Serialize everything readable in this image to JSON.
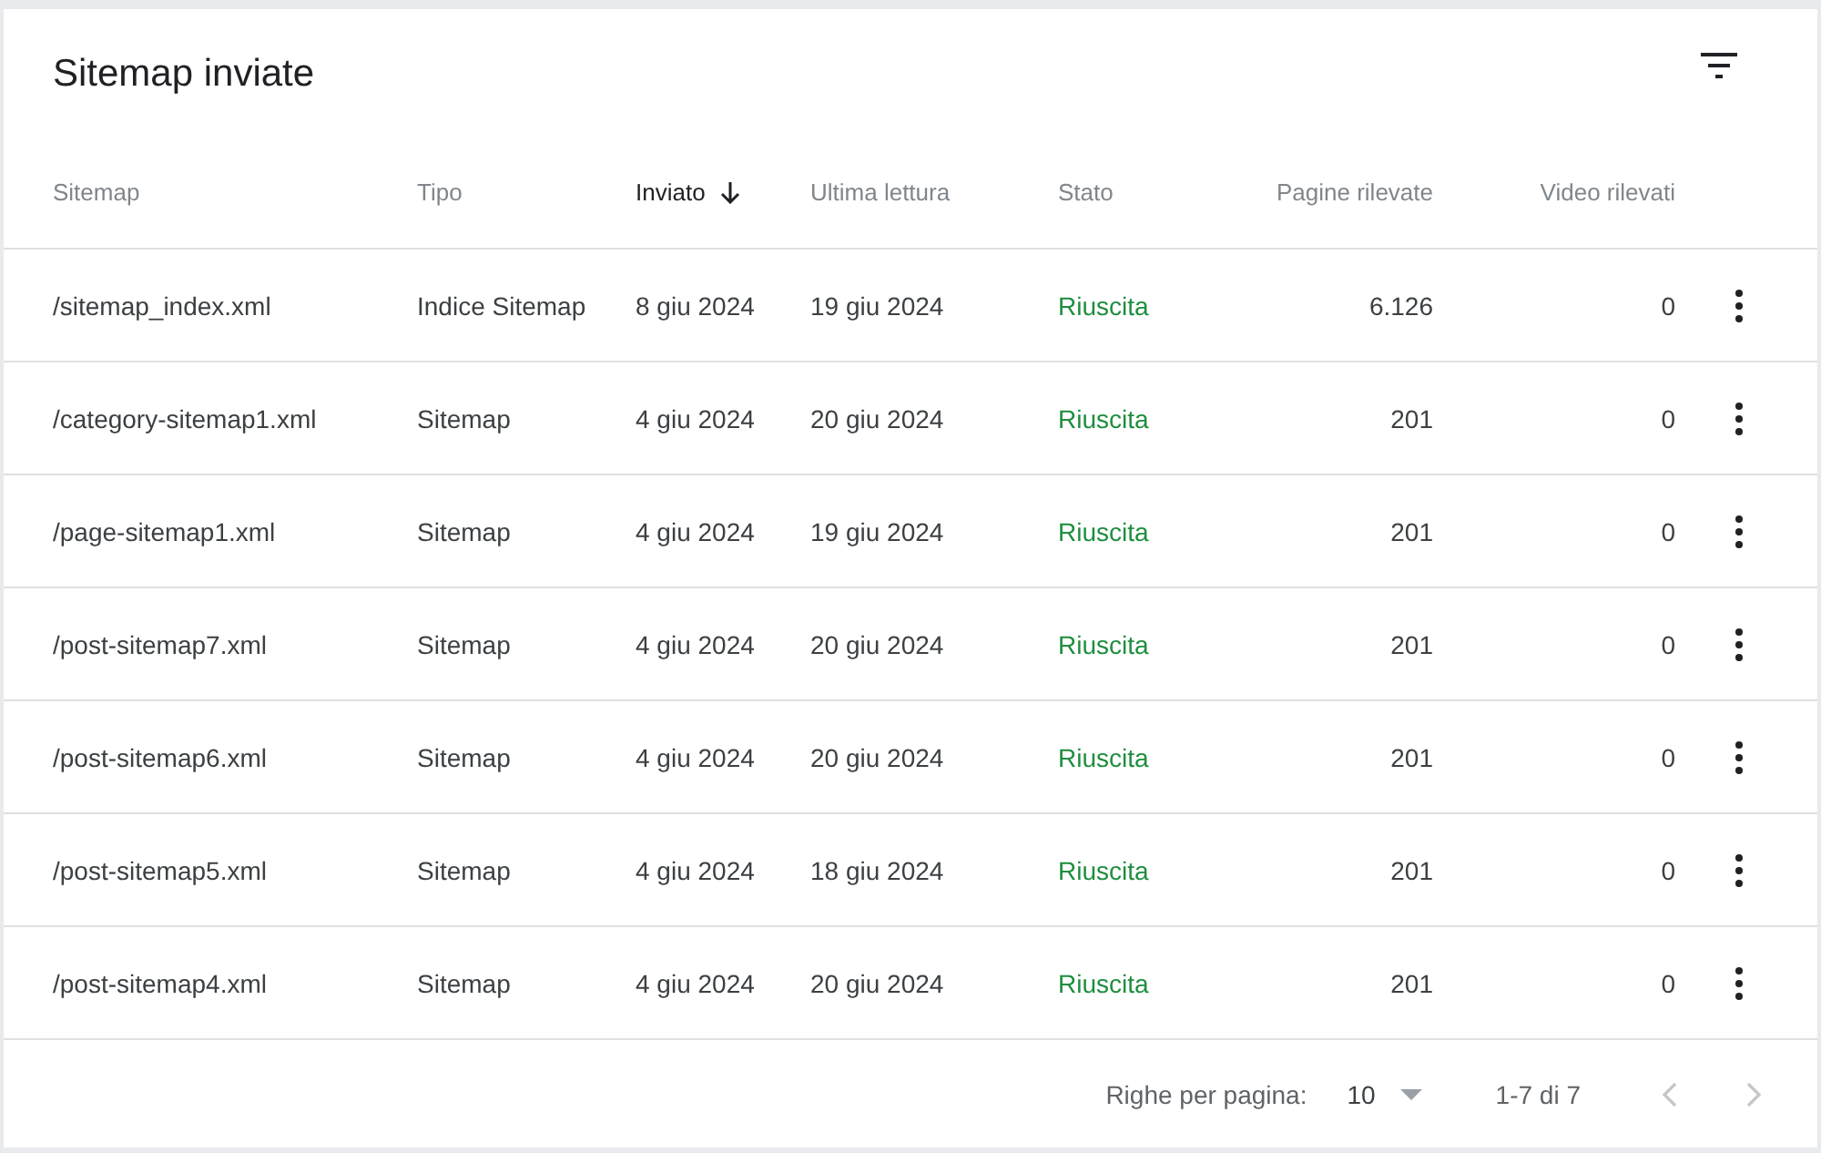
{
  "card": {
    "title": "Sitemap inviate"
  },
  "table": {
    "columns": [
      {
        "label": "Sitemap",
        "sorted": false,
        "numeric": false
      },
      {
        "label": "Tipo",
        "sorted": false,
        "numeric": false
      },
      {
        "label": "Inviato",
        "sorted": true,
        "numeric": false
      },
      {
        "label": "Ultima lettura",
        "sorted": false,
        "numeric": false
      },
      {
        "label": "Stato",
        "sorted": false,
        "numeric": false
      },
      {
        "label": "Pagine rilevate",
        "sorted": false,
        "numeric": true
      },
      {
        "label": "Video rilevati",
        "sorted": false,
        "numeric": true
      }
    ],
    "rows": [
      {
        "sitemap": "/sitemap_index.xml",
        "type": "Indice Sitemap",
        "submitted": "8 giu 2024",
        "last_read": "19 giu 2024",
        "status": "Riuscita",
        "color": "#1e8e3e",
        "pages": "6.126",
        "videos": "0"
      },
      {
        "sitemap": "/category-sitemap1.xml",
        "type": "Sitemap",
        "submitted": "4 giu 2024",
        "last_read": "20 giu 2024",
        "status": "Riuscita",
        "color": "#1e8e3e",
        "pages": "201",
        "videos": "0"
      },
      {
        "sitemap": "/page-sitemap1.xml",
        "type": "Sitemap",
        "submitted": "4 giu 2024",
        "last_read": "19 giu 2024",
        "status": "Riuscita",
        "color": "#1e8e3e",
        "pages": "201",
        "videos": "0"
      },
      {
        "sitemap": "/post-sitemap7.xml",
        "type": "Sitemap",
        "submitted": "4 giu 2024",
        "last_read": "20 giu 2024",
        "status": "Riuscita",
        "color": "#1e8e3e",
        "pages": "201",
        "videos": "0"
      },
      {
        "sitemap": "/post-sitemap6.xml",
        "type": "Sitemap",
        "submitted": "4 giu 2024",
        "last_read": "20 giu 2024",
        "status": "Riuscita",
        "color": "#1e8e3e",
        "pages": "201",
        "videos": "0"
      },
      {
        "sitemap": "/post-sitemap5.xml",
        "type": "Sitemap",
        "submitted": "4 giu 2024",
        "last_read": "18 giu 2024",
        "status": "Riuscita",
        "color": "#1e8e3e",
        "pages": "201",
        "videos": "0"
      },
      {
        "sitemap": "/post-sitemap4.xml",
        "type": "Sitemap",
        "submitted": "4 giu 2024",
        "last_read": "20 giu 2024",
        "status": "Riuscita",
        "color": "#1e8e3e",
        "pages": "201",
        "videos": "0"
      }
    ]
  },
  "pagination": {
    "rows_label": "Righe per pagina:",
    "rows_value": "10",
    "range": "1-7 di 7",
    "prev_disabled": true,
    "next_disabled": true
  }
}
